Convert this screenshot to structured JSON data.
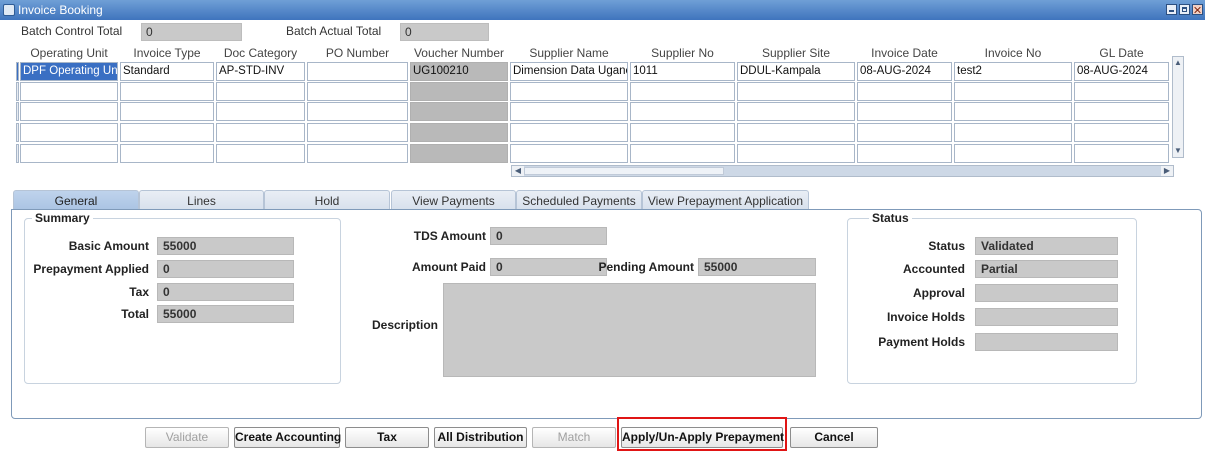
{
  "window": {
    "title": "Invoice Booking"
  },
  "batch": {
    "control_total_label": "Batch Control Total",
    "control_total_value": "0",
    "actual_total_label": "Batch Actual Total",
    "actual_total_value": "0"
  },
  "grid": {
    "columns": [
      "Operating Unit",
      "Invoice Type",
      "Doc Category",
      "PO Number",
      "Voucher Number",
      "Supplier Name",
      "Supplier No",
      "Supplier Site",
      "Invoice Date",
      "Invoice No",
      "GL Date"
    ],
    "rows": [
      [
        "DPF Operating Uni",
        "Standard",
        "AP-STD-INV",
        "",
        "UG100210",
        "Dimension Data Uganc",
        "1011",
        "DDUL-Kampala",
        "08-AUG-2024",
        "test2",
        "08-AUG-2024"
      ],
      [
        "",
        "",
        "",
        "",
        "",
        "",
        "",
        "",
        "",
        "",
        ""
      ],
      [
        "",
        "",
        "",
        "",
        "",
        "",
        "",
        "",
        "",
        "",
        ""
      ],
      [
        "",
        "",
        "",
        "",
        "",
        "",
        "",
        "",
        "",
        "",
        ""
      ],
      [
        "",
        "",
        "",
        "",
        "",
        "",
        "",
        "",
        "",
        "",
        ""
      ]
    ]
  },
  "tabs": [
    "General",
    "Lines",
    "Hold",
    "View Payments",
    "Scheduled Payments",
    "View Prepayment Application"
  ],
  "summary": {
    "title": "Summary",
    "basic_amount_label": "Basic Amount",
    "basic_amount": "55000",
    "prepayment_applied_label": "Prepayment Applied",
    "prepayment_applied": "0",
    "tax_label": "Tax",
    "tax": "0",
    "total_label": "Total",
    "total": "55000"
  },
  "middle": {
    "tds_amount_label": "TDS Amount",
    "tds_amount": "0",
    "amount_paid_label": "Amount Paid",
    "amount_paid": "0",
    "pending_amount_label": "Pending Amount",
    "pending_amount": "55000",
    "description_label": "Description",
    "description": ""
  },
  "status": {
    "title": "Status",
    "status_label": "Status",
    "status": "Validated",
    "accounted_label": "Accounted",
    "accounted": "Partial",
    "approval_label": "Approval",
    "approval": "",
    "invoice_holds_label": "Invoice Holds",
    "invoice_holds": "",
    "payment_holds_label": "Payment Holds",
    "payment_holds": ""
  },
  "buttons": {
    "validate": "Validate",
    "create_accounting": "Create Accounting",
    "tax": "Tax",
    "all_distribution": "All Distribution",
    "match": "Match",
    "apply_prepayment": "Apply/Un-Apply Prepayment",
    "cancel": "Cancel"
  }
}
